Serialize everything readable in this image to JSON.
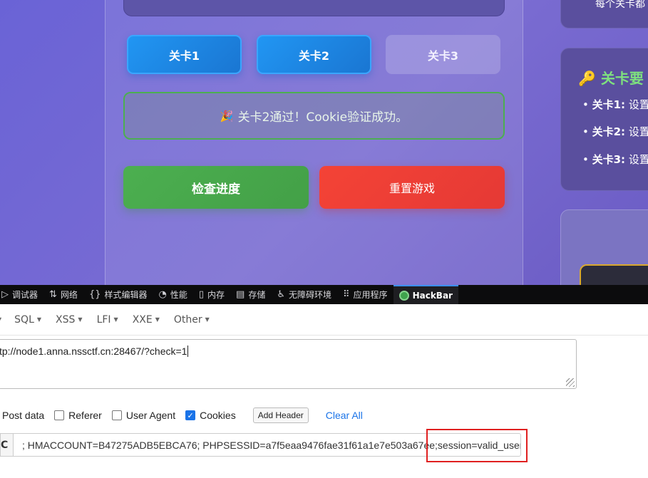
{
  "game": {
    "levels": [
      {
        "label": "关卡1",
        "state": "done"
      },
      {
        "label": "关卡2",
        "state": "done"
      },
      {
        "label": "关卡3",
        "state": "locked"
      }
    ],
    "message": {
      "icon": "party-popper-icon",
      "text": "关卡2通过！Cookie验证成功。"
    },
    "check_button": "检查进度",
    "reset_button": "重置游戏",
    "side_top_text": "每个关卡都",
    "requirements": {
      "title": "关卡要",
      "items": [
        {
          "label": "关卡1:",
          "text": "设置"
        },
        {
          "label": "关卡2:",
          "text": "设置"
        },
        {
          "label": "关卡3:",
          "text": "设置"
        }
      ]
    }
  },
  "devtools": {
    "tabs": [
      {
        "label": "调试器",
        "icon": "debugger-icon"
      },
      {
        "label": "网络",
        "icon": "network-icon"
      },
      {
        "label": "样式编辑器",
        "icon": "style-editor-icon"
      },
      {
        "label": "性能",
        "icon": "performance-icon"
      },
      {
        "label": "内存",
        "icon": "memory-icon"
      },
      {
        "label": "存储",
        "icon": "storage-icon"
      },
      {
        "label": "无障碍环境",
        "icon": "accessibility-icon"
      },
      {
        "label": "应用程序",
        "icon": "application-icon"
      },
      {
        "label": "HackBar",
        "icon": "hackbar-icon",
        "active": true
      }
    ]
  },
  "hackbar": {
    "menus": [
      "SQL",
      "XSS",
      "LFI",
      "XXE",
      "Other"
    ],
    "url": "tp://node1.anna.nssctf.cn:28467/?check=1",
    "options": {
      "post_data": "Post data",
      "referer": "Referer",
      "user_agent": "User Agent",
      "cookies": "Cookies",
      "cookies_checked": true,
      "referer_checked": false,
      "user_agent_checked": false
    },
    "add_header": "Add Header",
    "clear_all": "Clear All",
    "cookie_label": "C",
    "cookie_value": "; HMACCOUNT=B47275ADB5EBCA76; PHPSESSID=a7f5eaa9476fae31f61a1e7e503a67ee;session=valid_user"
  },
  "colors": {
    "accent": "#1a73e8",
    "success": "#4caf50",
    "danger": "#f44336",
    "highlight": "#e02020"
  }
}
